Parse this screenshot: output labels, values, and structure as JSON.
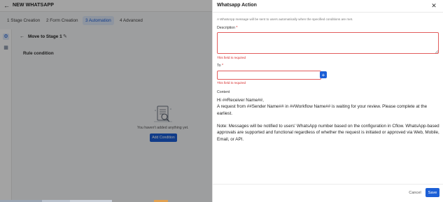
{
  "app": {
    "title": "NEW WHATSAPP",
    "tabs": [
      {
        "label": "1  Stage Creation"
      },
      {
        "label": "2  Form Creation"
      },
      {
        "label": "3  Automation",
        "active": true
      },
      {
        "label": "4  Advanced"
      }
    ],
    "stage": {
      "title": "Move to Stage 1"
    },
    "section_title": "Rule condition",
    "empty_message": "You haven't added anything yet.",
    "add_condition_label": "Add Condition"
  },
  "drawer": {
    "title": "Whatsapp Action",
    "hint": "A WhatsApp message will be sent to users automatically when the specified conditions are met.",
    "description_label": "Description",
    "description_value": "",
    "required_marker": "*",
    "error_required": "This field is required",
    "to_label": "To",
    "to_value": "",
    "content_label": "Content",
    "content_lines": {
      "greeting": "Hi ##Receiver Name##,",
      "body": "A request from ##Sender Name## in ##Workflow Name## is waiting for your review. Please complete at the earliest.",
      "note": "Note: Messages will be notified to users' WhatsApp number based on the configuration in Cflow. WhatsApp-based approvals are supported and functional regardless of whether the request is initiated or approved via Web, Mobile, Email, or API."
    },
    "cancel_label": "Cancel",
    "save_label": "Save"
  },
  "colors": {
    "accent": "#1c5fd6",
    "error": "#d62828",
    "overlay": "rgba(0,0,0,0.36)"
  },
  "icons": {
    "back": "arrow-left-icon",
    "edit": "pencil-icon",
    "close": "close-icon",
    "add": "plus-icon",
    "rail_settings": "gear-icon",
    "rail_calendar": "calendar-icon"
  }
}
